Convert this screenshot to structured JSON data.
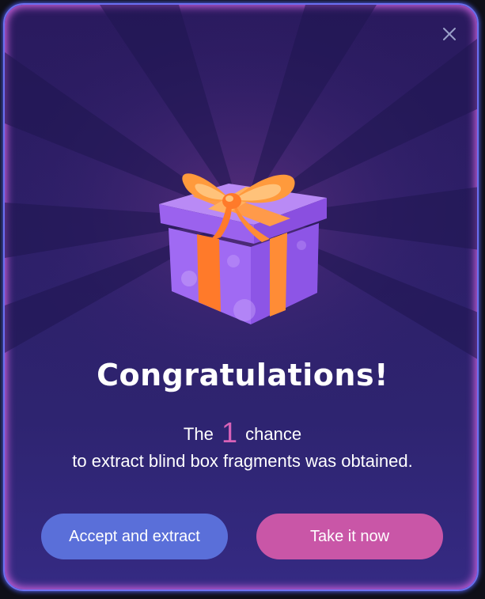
{
  "dialog": {
    "title": "Congratulations!",
    "message": {
      "prefix": "The",
      "count": "1",
      "suffix": "chance",
      "line2": "to extract blind box fragments was obtained."
    },
    "buttons": {
      "accept_label": "Accept and extract",
      "take_label": "Take it now"
    },
    "icons": {
      "close": "close-icon",
      "gift": "gift-box-icon"
    },
    "colors": {
      "accent_count": "#d862b8",
      "accept_button": "#5a6fd9",
      "take_button": "#c956a7",
      "border": "#6a6ff0"
    }
  }
}
